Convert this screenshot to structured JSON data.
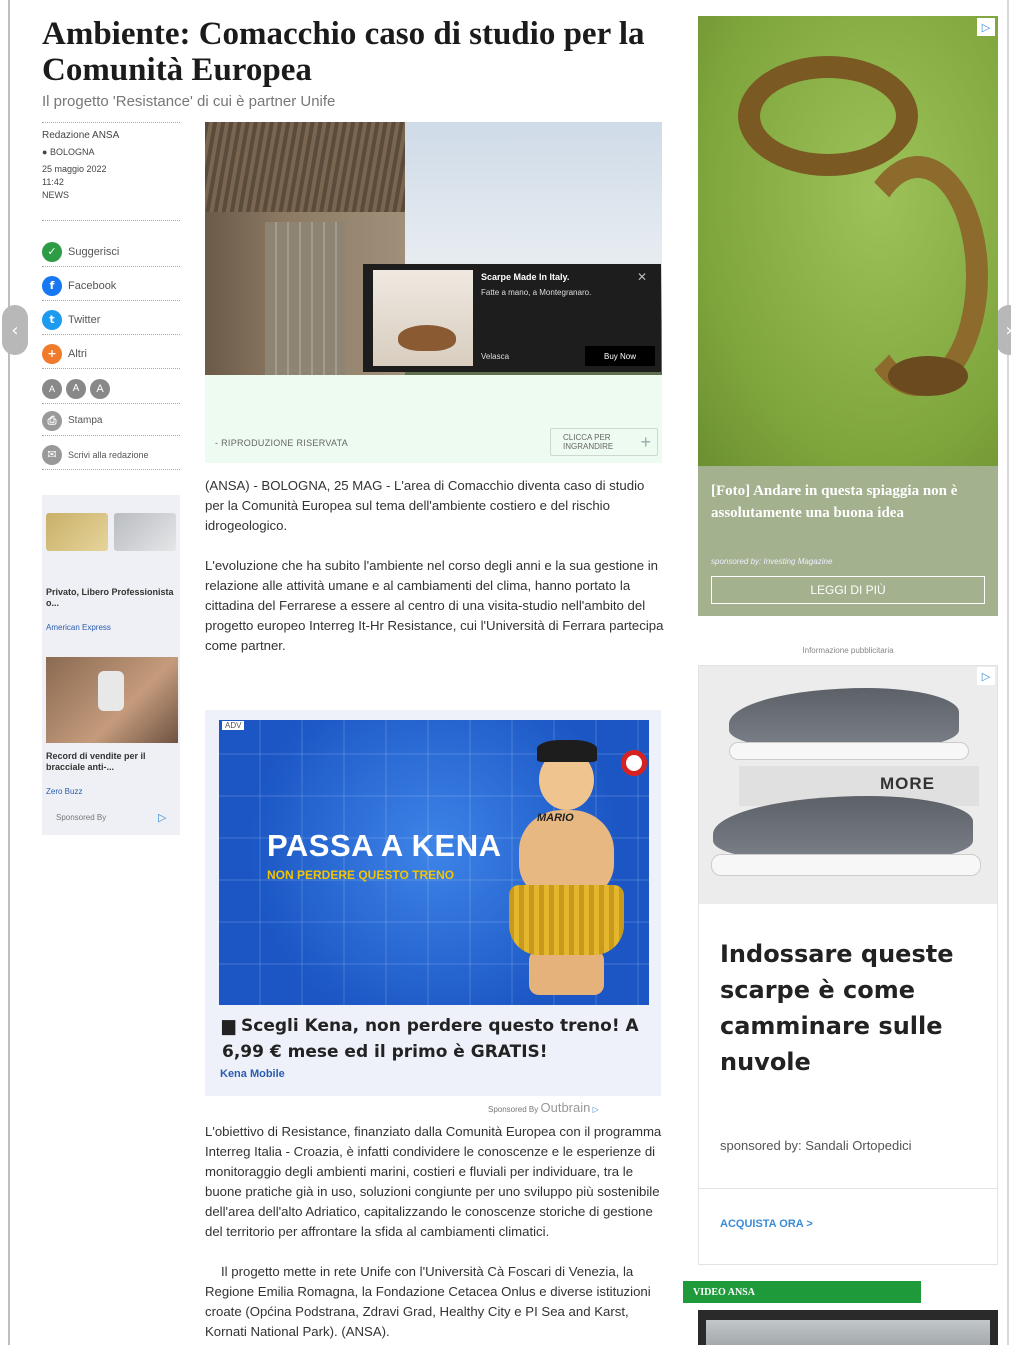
{
  "article": {
    "headline": "Ambiente: Comacchio caso di studio per la Comunità Europea",
    "subhead": "Il progetto 'Resistance' di cui è partner Unife",
    "author": "Redazione ANSA",
    "location": "BOLOGNA",
    "date": "25 maggio 2022",
    "time": "11:42",
    "category": "NEWS",
    "paragraph1": "(ANSA) - BOLOGNA, 25 MAG - L'area di Comacchio diventa caso di studio per la Comunità Europea sul tema dell'ambiente costiero e del rischio idrogeologico.",
    "paragraph2": "L'evoluzione che ha subito l'ambiente nel corso degli anni e la sua gestione in relazione alle attività umane e al cambiamenti del clima, hanno portato la cittadina del Ferrarese a essere al centro di una visita-studio nell'ambito del progetto europeo Interreg It-Hr Resistance, cui l'Università di Ferrara partecipa come partner.",
    "paragraph3": "L'obiettivo di Resistance, finanziato dalla Comunità Europea con il programma Interreg Italia - Croazia, è infatti condividere le conoscenze e le esperienze di monitoraggio degli ambienti marini, costieri e fluviali per individuare, tra le buone pratiche già in uso, soluzioni congiunte per uno sviluppo più sostenibile dell'area dell'alto Adriatico, capitalizzando le conoscenze storiche di gestione del territorio per affrontare la sfida al cambiamenti climatici.",
    "paragraph4": "Il progetto mette in rete Unife con l'Università Cà Foscari di Venezia, la Regione Emilia Romagna, la Fondazione Cetacea Onlus e diverse istituzioni croate (Općina Podstrana, Zdravi Grad, Healthy City e PI Sea and Karst, Kornati National Park). (ANSA).",
    "image_caption": "- RIPRODUZIONE RISERVATA",
    "enlarge_label": "CLICCA PER INGRANDIRE"
  },
  "share": {
    "suggest": "Suggerisci",
    "facebook": "Facebook",
    "twitter": "Twitter",
    "others": "Altri",
    "text_sizes": [
      "A",
      "A",
      "A"
    ],
    "print": "Stampa",
    "write": "Scrivi alla redazione"
  },
  "left_sponsored": {
    "item1_title": "Privato, Libero Professionista o...",
    "item1_source": "American Express",
    "item2_title": "Record di vendite per il bracciale anti-...",
    "item2_source": "Zero Buzz",
    "sponsored_by": "Sponsored By"
  },
  "image_popup": {
    "title": "Scarpe Made In Italy.",
    "subtitle": "Fatte a mano, a Montegranaro.",
    "brand": "Velasca",
    "cta": "Buy Now",
    "close": "✕"
  },
  "mid_ad": {
    "tag": "ADV",
    "headline": "PASSA A KENA",
    "subline": "NON PERDERE QUESTO TRENO",
    "badge": "MARIO",
    "title": "Scegli Kena, non perdere questo treno! A 6,99 € mese ed il primo è GRATIS!",
    "brand": "Kena Mobile",
    "sponsored_by": "Sponsored By",
    "network": "Outbrain"
  },
  "right_ad1": {
    "title": "[Foto] Andare in questa spiaggia non è assolutamente una buona idea",
    "sponsor": "sponsored by: Investing Magazine",
    "cta": "LEGGI DI PIÙ"
  },
  "right_ad2": {
    "info": "Informazione pubblicitaria",
    "badge": "MORE",
    "title": "Indossare queste scarpe è come camminare sulle nuvole",
    "sponsor": "sponsored by: Sandali Ortopedici",
    "cta": "ACQUISTA ORA >"
  },
  "video": {
    "label": "VIDEO ANSA"
  },
  "icons": {
    "prev": "‹",
    "next": "›",
    "ad_choice": "▷",
    "plus": "+"
  }
}
